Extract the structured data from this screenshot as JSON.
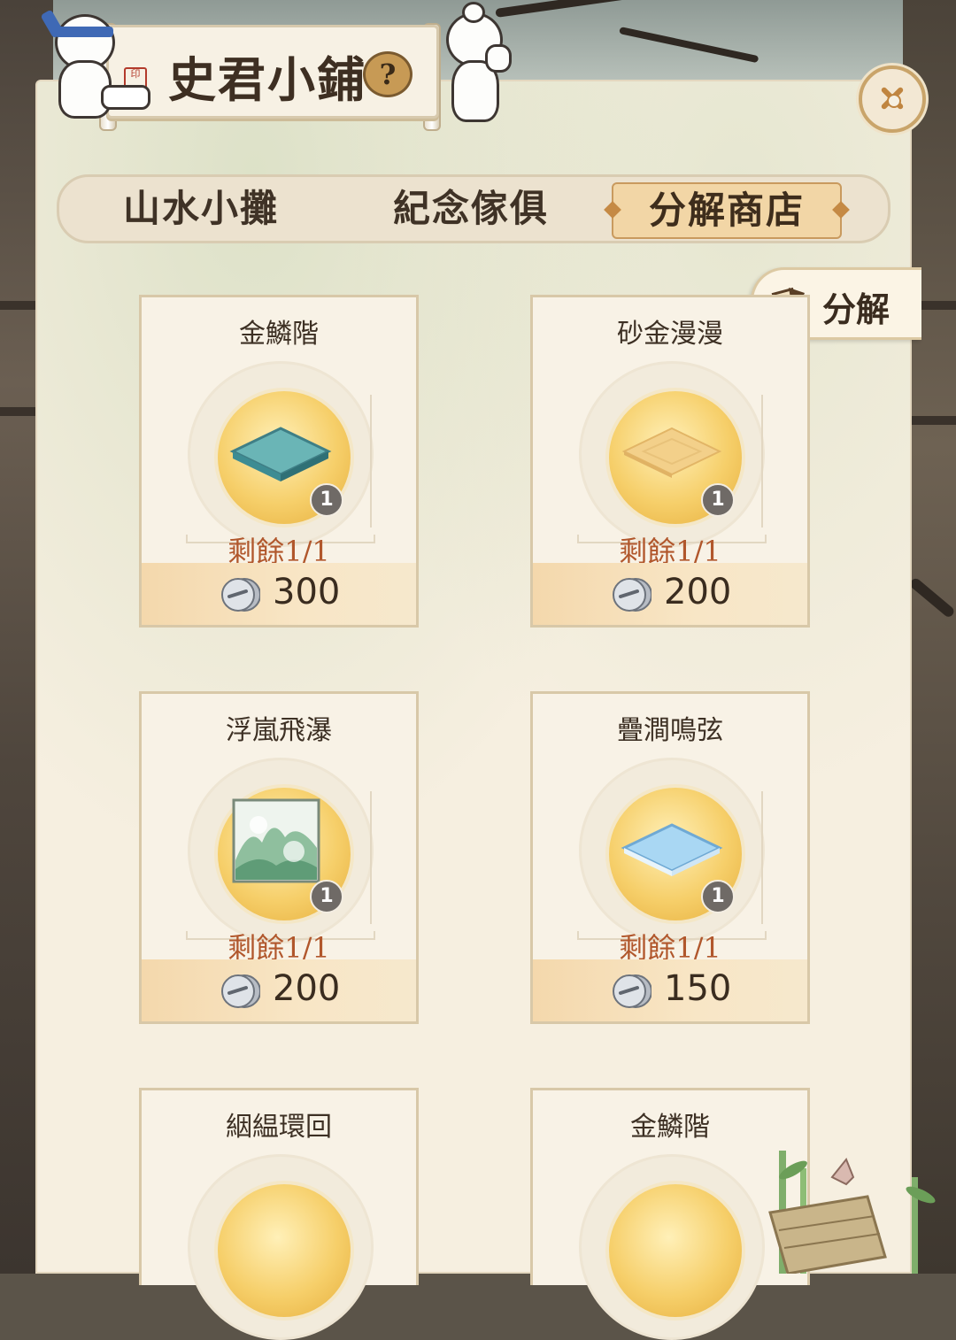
{
  "header": {
    "title": "史君小鋪",
    "help_icon": "?",
    "seal_text": "印"
  },
  "tabs": [
    {
      "label": "山水小攤",
      "active": false
    },
    {
      "label": "紀念傢俱",
      "active": false
    },
    {
      "label": "分解商店",
      "active": true
    }
  ],
  "decompose_button": {
    "label": "分解"
  },
  "items": [
    {
      "name": "金鱗階",
      "quantity": "1",
      "remaining": "剩餘1/1",
      "price": "300",
      "icon": "teal-floor-tile"
    },
    {
      "name": "砂金漫漫",
      "quantity": "1",
      "remaining": "剩餘1/1",
      "price": "200",
      "icon": "gold-floor-tile"
    },
    {
      "name": "浮嵐飛瀑",
      "quantity": "1",
      "remaining": "剩餘1/1",
      "price": "200",
      "icon": "landscape-painting"
    },
    {
      "name": "疊澗鳴弦",
      "quantity": "1",
      "remaining": "剩餘1/1",
      "price": "150",
      "icon": "blue-floor-tile"
    },
    {
      "name": "絪緼環回",
      "quantity": "",
      "remaining": "",
      "price": "",
      "icon": "floor-tile"
    },
    {
      "name": "金鱗階",
      "quantity": "",
      "remaining": "",
      "price": "",
      "icon": "floor-tile"
    }
  ],
  "colors": {
    "panel": "#f6efe0",
    "price_text": "#3a2c1f",
    "remaining_text": "#b1572c",
    "active_tab": "#f2d6a6"
  }
}
